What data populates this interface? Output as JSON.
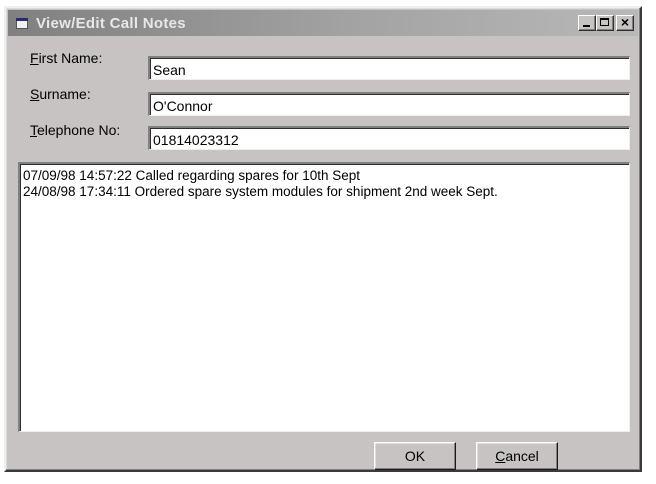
{
  "window": {
    "title": "View/Edit Call Notes",
    "close_glyph": "×"
  },
  "fields": {
    "first_name": {
      "label_accel": "F",
      "label_rest": "irst Name:",
      "value": "Sean"
    },
    "surname": {
      "label_accel": "S",
      "label_rest": "urname:",
      "value": "O'Connor"
    },
    "telephone": {
      "label_accel": "T",
      "label_rest": "elephone No:",
      "value": "01814023312"
    }
  },
  "notes": {
    "lines": [
      "07/09/98 14:57:22 Called regarding spares for 10th Sept",
      "24/08/98 17:34:11 Ordered spare system modules for shipment 2nd week Sept."
    ]
  },
  "buttons": {
    "ok": {
      "label": "OK"
    },
    "cancel": {
      "label_accel": "C",
      "label_rest": "ancel"
    }
  },
  "icons": {
    "title": "notepad-icon",
    "minimize": "minimize-icon",
    "maximize": "maximize-icon",
    "close": "close-icon"
  }
}
